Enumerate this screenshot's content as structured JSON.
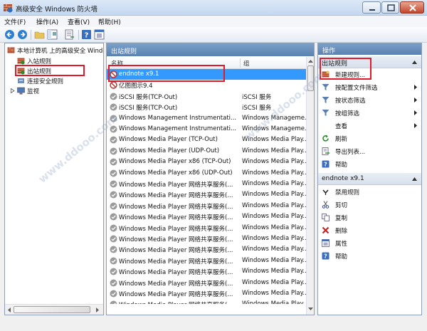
{
  "window": {
    "title": "高级安全 Windows 防火墙"
  },
  "menu": [
    "文件(F)",
    "操作(A)",
    "查看(V)",
    "帮助(H)"
  ],
  "tree": {
    "root": "本地计算机 上的高级安全 Windows 防火墙",
    "items": [
      "入站规则",
      "出站规则",
      "连接安全规则",
      "监视"
    ]
  },
  "center": {
    "title": "出站规则",
    "columns": {
      "name": "名称",
      "group": "组"
    },
    "rows": [
      {
        "name": "endnote x9.1",
        "group": "",
        "icon": "blocked-icon",
        "selected": true
      },
      {
        "name": "亿图图示9.4",
        "group": "",
        "icon": "blocked-icon"
      },
      {
        "name": "iSCSI 服务(TCP-Out)",
        "group": "iSCSI 服务",
        "icon": "disabled-icon"
      },
      {
        "name": "iSCSI 服务(TCP-Out)",
        "group": "iSCSI 服务",
        "icon": "disabled-icon"
      },
      {
        "name": "Windows Management Instrumentati...",
        "group": "Windows Manageme...",
        "icon": "disabled-icon"
      },
      {
        "name": "Windows Management Instrumentati...",
        "group": "Windows Manageme...",
        "icon": "disabled-icon"
      },
      {
        "name": "Windows Media Player (TCP-Out)",
        "group": "Windows Media Play...",
        "icon": "disabled-icon"
      },
      {
        "name": "Windows Media Player (UDP-Out)",
        "group": "Windows Media Play...",
        "icon": "disabled-icon"
      },
      {
        "name": "Windows Media Player x86 (TCP-Out)",
        "group": "Windows Media Play...",
        "icon": "disabled-icon"
      },
      {
        "name": "Windows Media Player x86 (UDP-Out)",
        "group": "Windows Media Play...",
        "icon": "disabled-icon"
      },
      {
        "name": "Windows Media Player 网络共享服务(...",
        "group": "Windows Media Play...",
        "icon": "disabled-icon"
      },
      {
        "name": "Windows Media Player 网络共享服务(...",
        "group": "Windows Media Play...",
        "icon": "disabled-icon"
      },
      {
        "name": "Windows Media Player 网络共享服务(...",
        "group": "Windows Media Play...",
        "icon": "disabled-icon"
      },
      {
        "name": "Windows Media Player 网络共享服务(...",
        "group": "Windows Media Play...",
        "icon": "disabled-icon"
      },
      {
        "name": "Windows Media Player 网络共享服务(...",
        "group": "Windows Media Play...",
        "icon": "disabled-icon"
      },
      {
        "name": "Windows Media Player 网络共享服务(...",
        "group": "Windows Media Play...",
        "icon": "disabled-icon"
      },
      {
        "name": "Windows Media Player 网络共享服务(...",
        "group": "Windows Media Play...",
        "icon": "disabled-icon"
      },
      {
        "name": "Windows Media Player 网络共享服务(...",
        "group": "Windows Media Play...",
        "icon": "disabled-icon"
      },
      {
        "name": "Windows Media Player 网络共享服务(...",
        "group": "Windows Media Play...",
        "icon": "disabled-icon"
      },
      {
        "name": "Windows Media Player 网络共享服务(...",
        "group": "Windows Media Play...",
        "icon": "disabled-icon"
      },
      {
        "name": "Windows Media Player 网络共享服务(...",
        "group": "Windows Media Play...",
        "icon": "disabled-icon"
      },
      {
        "name": "Windows Media Player 网络共享服务(...",
        "group": "Windows Media Play...",
        "icon": "disabled-icon"
      }
    ]
  },
  "actions": {
    "header": "操作",
    "section1": {
      "title": "出站规则",
      "items": [
        {
          "label": "新建规则...",
          "icon": "new-rule-icon"
        },
        {
          "label": "按配置文件筛选",
          "icon": "filter-icon",
          "submenu": true
        },
        {
          "label": "按状态筛选",
          "icon": "filter-icon",
          "submenu": true
        },
        {
          "label": "按组筛选",
          "icon": "filter-icon",
          "submenu": true
        },
        {
          "label": "查看",
          "icon": "",
          "submenu": true
        },
        {
          "label": "刷新",
          "icon": "refresh-icon"
        },
        {
          "label": "导出列表...",
          "icon": "export-icon"
        },
        {
          "label": "帮助",
          "icon": "help-icon"
        }
      ]
    },
    "section2": {
      "title": "endnote x9.1",
      "items": [
        {
          "label": "禁用规则",
          "icon": "disable-icon"
        },
        {
          "label": "剪切",
          "icon": "cut-icon"
        },
        {
          "label": "复制",
          "icon": "copy-icon"
        },
        {
          "label": "删除",
          "icon": "delete-icon"
        },
        {
          "label": "属性",
          "icon": "properties-icon"
        },
        {
          "label": "帮助",
          "icon": "help-icon"
        }
      ]
    }
  },
  "colors": {
    "selection": "#3399ff",
    "highlight_box": "#e01a2a",
    "pane_header": "#5a82b0"
  }
}
